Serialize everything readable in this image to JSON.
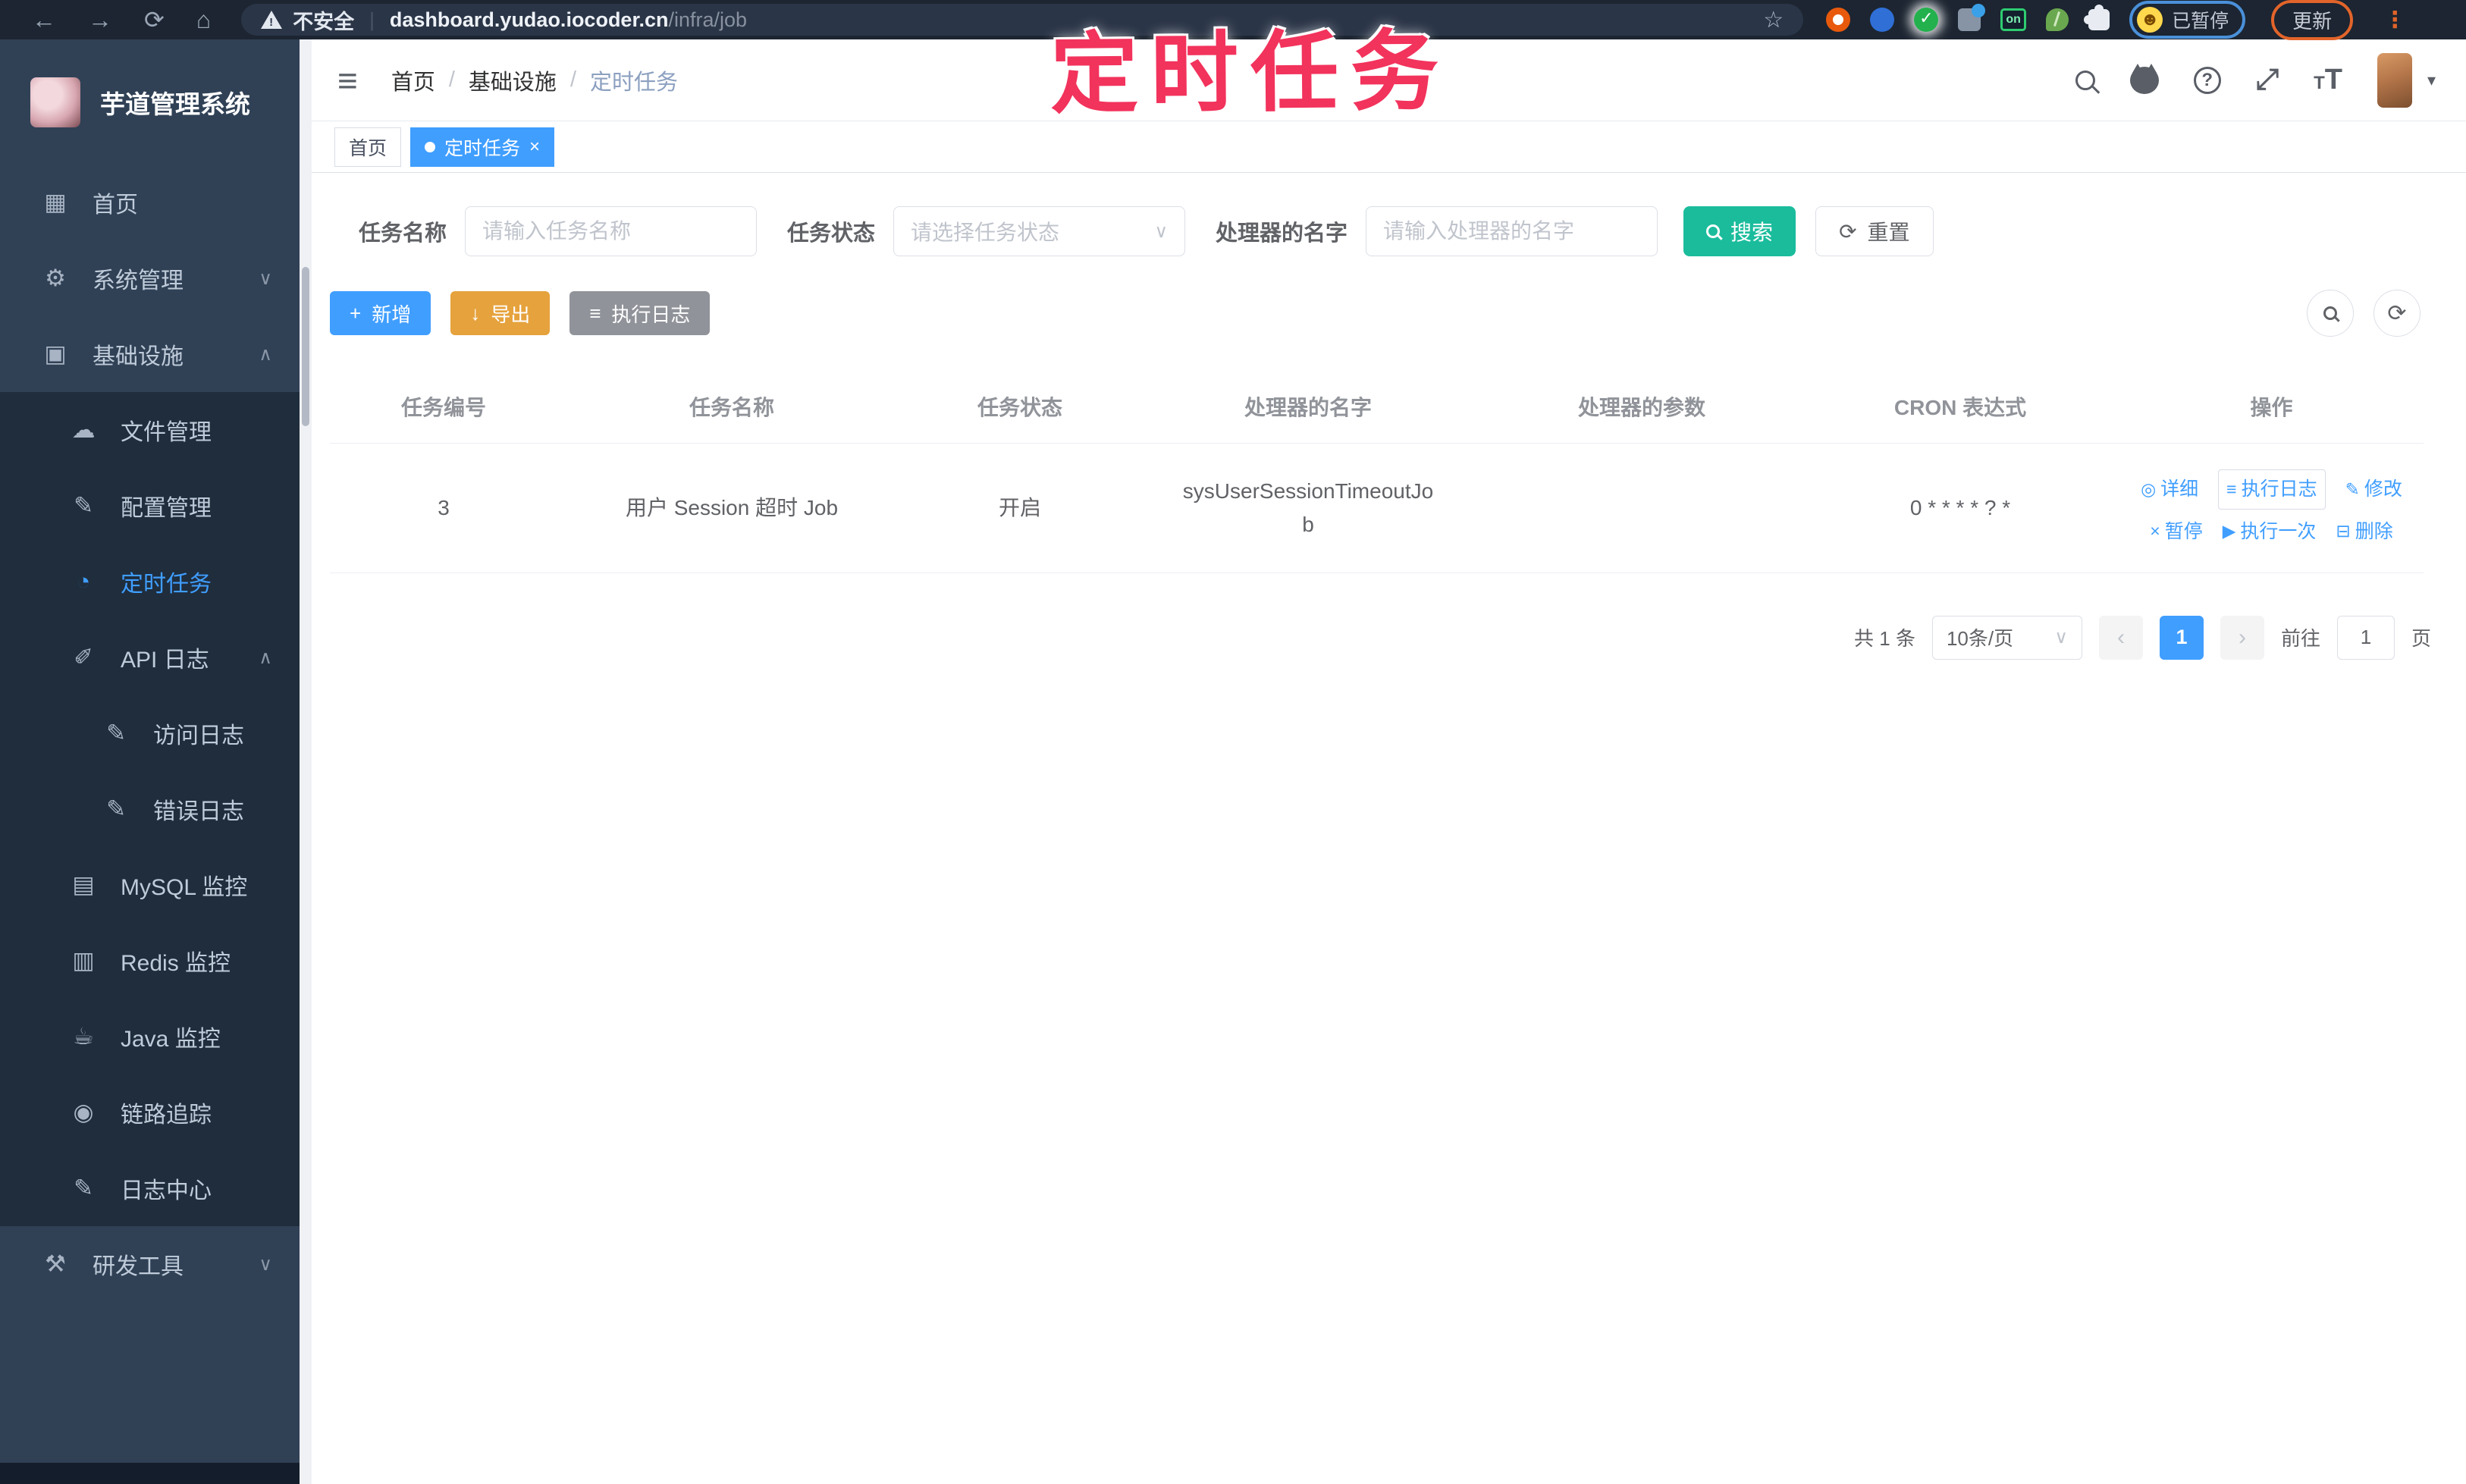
{
  "browser": {
    "security_label": "不安全",
    "url_host": "dashboard.yudao.iocoder.cn",
    "url_path": "/infra/job",
    "extension_badge": "on",
    "profile_status": "已暂停",
    "update_label": "更新"
  },
  "watermark": "定时任务",
  "sidebar": {
    "title": "芋道管理系统",
    "items": [
      {
        "label": "首页",
        "glyph": "▦",
        "chevron": ""
      },
      {
        "label": "系统管理",
        "glyph": "⚙",
        "chevron": "∨"
      },
      {
        "label": "基础设施",
        "glyph": "▣",
        "chevron": "∧"
      },
      {
        "label": "文件管理",
        "glyph": "☁",
        "chevron": ""
      },
      {
        "label": "配置管理",
        "glyph": "✎",
        "chevron": ""
      },
      {
        "label": "定时任务",
        "glyph": "◔",
        "chevron": ""
      },
      {
        "label": "API 日志",
        "glyph": "✐",
        "chevron": "∧"
      },
      {
        "label": "访问日志",
        "glyph": "✎",
        "chevron": ""
      },
      {
        "label": "错误日志",
        "glyph": "✎",
        "chevron": ""
      },
      {
        "label": "MySQL 监控",
        "glyph": "▤",
        "chevron": ""
      },
      {
        "label": "Redis 监控",
        "glyph": "▥",
        "chevron": ""
      },
      {
        "label": "Java 监控",
        "glyph": "☕",
        "chevron": ""
      },
      {
        "label": "链路追踪",
        "glyph": "◉",
        "chevron": ""
      },
      {
        "label": "日志中心",
        "glyph": "✎",
        "chevron": ""
      },
      {
        "label": "研发工具",
        "glyph": "⚒",
        "chevron": "∨"
      }
    ]
  },
  "header": {
    "breadcrumb": [
      "首页",
      "基础设施",
      "定时任务"
    ],
    "separator": "/"
  },
  "tabs": [
    {
      "label": "首页"
    },
    {
      "label": "定时任务",
      "close": "×"
    }
  ],
  "filters": {
    "task_name": {
      "label": "任务名称",
      "placeholder": "请输入任务名称"
    },
    "task_status": {
      "label": "任务状态",
      "placeholder": "请选择任务状态"
    },
    "handler_name": {
      "label": "处理器的名字",
      "placeholder": "请输入处理器的名字"
    },
    "search_label": "搜索",
    "reset_label": "重置",
    "reset_glyph": "⟳"
  },
  "toolbar": {
    "add_label": "新增",
    "add_glyph": "+",
    "export_label": "导出",
    "export_glyph": "↓",
    "exec_log_label": "执行日志",
    "exec_log_glyph": "≡",
    "refresh_glyph": "⟳"
  },
  "table": {
    "headers": [
      "任务编号",
      "任务名称",
      "任务状态",
      "处理器的名字",
      "处理器的参数",
      "CRON 表达式",
      "操作"
    ],
    "row": {
      "id": "3",
      "name": "用户 Session 超时 Job",
      "status": "开启",
      "handler": "sysUserSessionTimeoutJob",
      "param": "",
      "cron": "0 * * * * ? *",
      "actions": [
        {
          "label": "详细",
          "glyph": "◎"
        },
        {
          "label": "执行日志",
          "glyph": "≡"
        },
        {
          "label": "修改",
          "glyph": "✎"
        },
        {
          "label": "暂停",
          "glyph": "×"
        },
        {
          "label": "执行一次",
          "glyph": "▶"
        },
        {
          "label": "删除",
          "glyph": "⊟"
        }
      ]
    }
  },
  "pagination": {
    "total": "共 1 条",
    "page_size": "10条/页",
    "prev": "‹",
    "page": "1",
    "next": "›",
    "goto_prefix": "前往",
    "goto_value": "1",
    "goto_suffix": "页"
  },
  "colors": {
    "primary": "#409EFF",
    "warning": "#E6A23C",
    "info": "#909399",
    "search_teal": "#1ABC9C",
    "sidebar_bg": "#304156",
    "submenu_bg": "#1f2d3d",
    "topbar_bg": "#1c2531",
    "watermark_pink": "#f2335c"
  }
}
